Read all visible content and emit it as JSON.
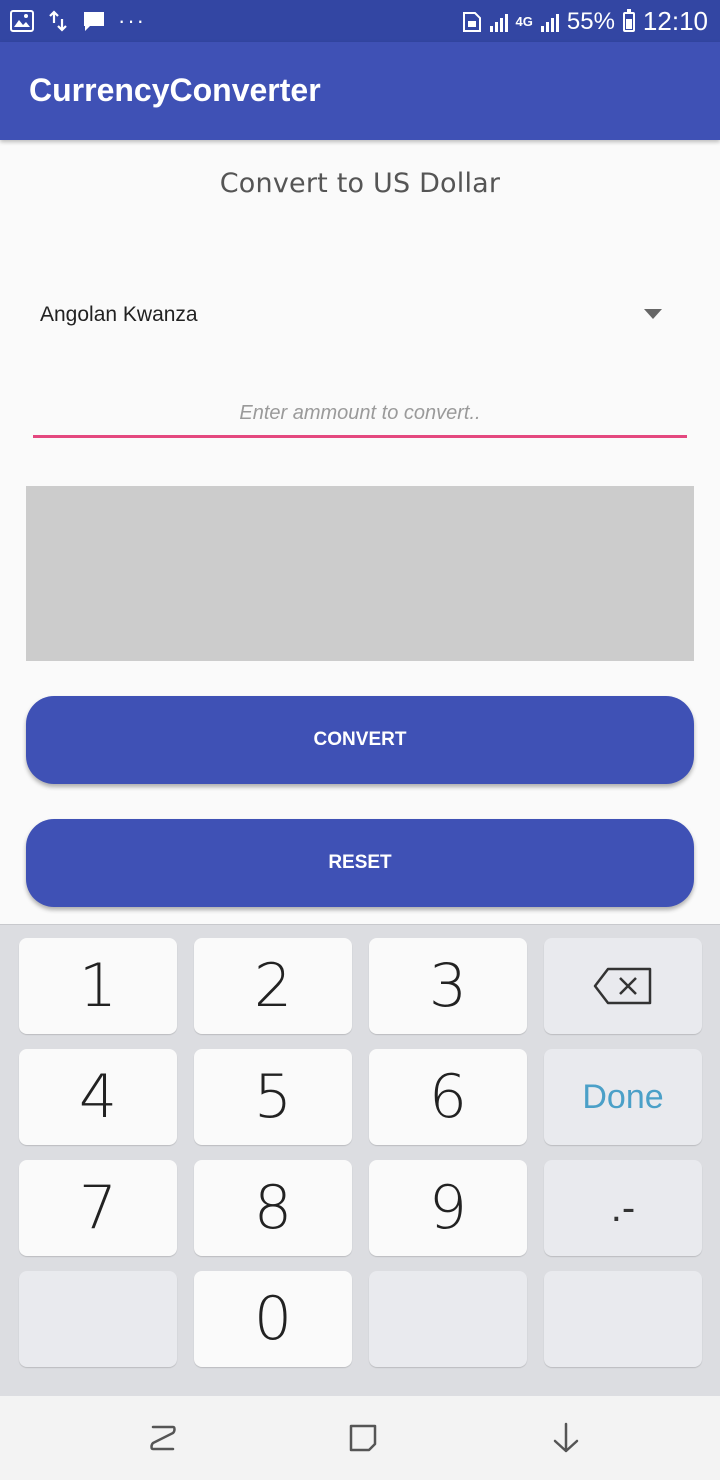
{
  "status_bar": {
    "more_icons": "···",
    "battery_text": "55%",
    "time": "12:10",
    "network": "4G"
  },
  "app_bar": {
    "title": "CurrencyConverter"
  },
  "main": {
    "subtitle": "Convert to US Dollar",
    "currency_selected": "Angolan Kwanza",
    "amount_value": "",
    "amount_placeholder": "Enter ammount to convert..",
    "result_text": "",
    "convert_label": "CONVERT",
    "reset_label": "RESET"
  },
  "keyboard": {
    "keys": [
      "1",
      "2",
      "3",
      "4",
      "5",
      "6",
      "7",
      "8",
      "9",
      "0"
    ],
    "done_label": "Done",
    "dot_minus_label": ".-"
  },
  "colors": {
    "status_bar": "#3346a3",
    "primary": "#3f51b5",
    "accent": "#e4487f",
    "result_box": "#cccccc",
    "done_text": "#4ba0c8"
  }
}
